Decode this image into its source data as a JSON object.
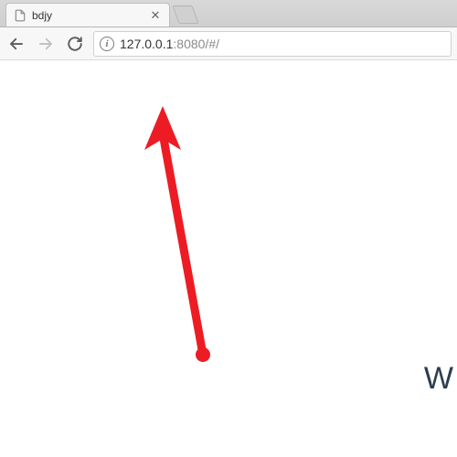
{
  "tab": {
    "title": "bdjy"
  },
  "address": {
    "host": "127.0.0.1",
    "port_and_path": ":8080/#/"
  },
  "page": {
    "partial_text": "W"
  },
  "colors": {
    "arrow": "#ed1c24"
  }
}
